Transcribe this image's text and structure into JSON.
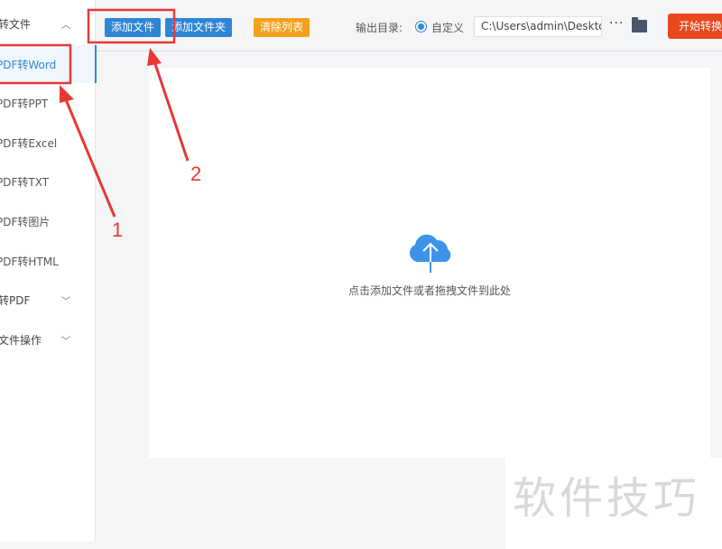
{
  "sidebar": {
    "group_top": "转文件",
    "items": [
      "PDF转Word",
      "PDF转PPT",
      "PDF转Excel",
      "PDF转TXT",
      "PDF转图片",
      "PDF转HTML"
    ],
    "group_to_pdf": "转PDF",
    "group_file_ops": "文件操作"
  },
  "toolbar": {
    "add_file": "添加文件",
    "add_folder": "添加文件夹",
    "clear_list": "清除列表",
    "output_label": "输出目录:",
    "custom_option": "自定义",
    "output_path": "C:\\Users\\admin\\Deskto",
    "more": "···",
    "start": "开始转换"
  },
  "drop_zone": {
    "hint": "点击添加文件或者拖拽文件到此处"
  },
  "annotations": {
    "label_1": "1",
    "label_2": "2",
    "color": "#e53935"
  },
  "watermark": "软件技巧"
}
